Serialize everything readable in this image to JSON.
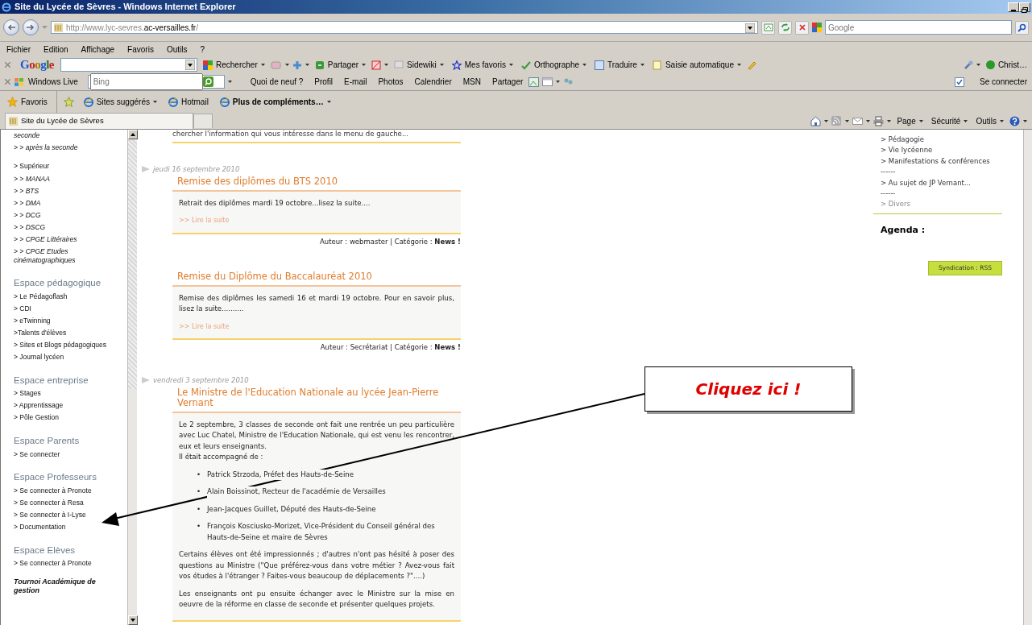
{
  "window": {
    "title": "Site du Lycée de Sèvres - Windows Internet Explorer"
  },
  "address_bar": {
    "url_start": "http://www.lyc-sevres.",
    "url_domain": "ac-versailles.fr",
    "url_end": "/",
    "search_placeholder": "Google"
  },
  "menu": [
    "Fichier",
    "Edition",
    "Affichage",
    "Favoris",
    "Outils",
    "?"
  ],
  "google_toolbar": {
    "logo": "Google",
    "items": [
      "Rechercher",
      "Partager",
      "Sidewiki",
      "Mes favoris",
      "Orthographe",
      "Traduire",
      "Saisie automatique"
    ],
    "user": "Christ…"
  },
  "live_toolbar": {
    "brand": "Windows Live",
    "search_placeholder": "Bing",
    "items": [
      "Quoi de neuf ?",
      "Profil",
      "E-mail",
      "Photos",
      "Calendrier",
      "MSN",
      "Partager"
    ],
    "connect": "Se connecter"
  },
  "favorites_bar": {
    "favorites": "Favoris",
    "items": [
      {
        "label": "Sites suggérés",
        "kind": "link"
      },
      {
        "label": "Hotmail",
        "kind": "plain"
      },
      {
        "label": "Plus de compléments…",
        "kind": "gallery"
      }
    ]
  },
  "tab": {
    "title": "Site du Lycée de Sèvres"
  },
  "command_bar": [
    "Page",
    "Sécurité",
    "Outils"
  ],
  "sidebar": {
    "sections": [
      {
        "items": [
          {
            "label": "seconde",
            "kind": "sub"
          },
          {
            "label": "> > après la seconde",
            "kind": "sub"
          }
        ]
      },
      {
        "items": [
          {
            "label": "> Supérieur",
            "kind": "link"
          },
          {
            "label": "> > MANAA",
            "kind": "sub"
          },
          {
            "label": "> > BTS",
            "kind": "sub"
          },
          {
            "label": "> > DMA",
            "kind": "sub"
          },
          {
            "label": "> > DCG",
            "kind": "sub"
          },
          {
            "label": "> > DSCG",
            "kind": "sub"
          },
          {
            "label": "> > CPGE Littéraires",
            "kind": "sub"
          },
          {
            "label": "> > CPGE Etudes cinématographiques",
            "kind": "sub"
          }
        ]
      },
      {
        "heading": "Espace pédagogique",
        "items": [
          {
            "label": "> Le Pédagoflash",
            "kind": "link"
          },
          {
            "label": "> CDI",
            "kind": "link"
          },
          {
            "label": "> eTwinning",
            "kind": "link"
          },
          {
            "label": ">Talents d'élèves",
            "kind": "link"
          },
          {
            "label": "> Sites et Blogs pédagogiques",
            "kind": "link"
          },
          {
            "label": "> Journal lycéen",
            "kind": "link"
          }
        ]
      },
      {
        "heading": "Espace entreprise",
        "items": [
          {
            "label": "> Stages",
            "kind": "link"
          },
          {
            "label": "> Apprentissage",
            "kind": "link"
          },
          {
            "label": "> Pôle Gestion",
            "kind": "link"
          }
        ]
      },
      {
        "heading": "Espace Parents",
        "items": [
          {
            "label": "> Se connecter",
            "kind": "link"
          }
        ]
      },
      {
        "heading": "Espace Professeurs",
        "items": [
          {
            "label": "> Se connecter à Pronote",
            "kind": "link"
          },
          {
            "label": "> Se connecter à Resa",
            "kind": "link"
          },
          {
            "label": "> Se connecter à I-Lyse",
            "kind": "link"
          },
          {
            "label": "> Documentation",
            "kind": "link"
          }
        ]
      },
      {
        "heading": "Espace Elèves",
        "items": [
          {
            "label": "> Se connecter à Pronote",
            "kind": "link"
          }
        ]
      },
      {
        "items": [
          {
            "label": "Tournoi Académique de gestion",
            "kind": "feature"
          }
        ]
      }
    ]
  },
  "main": {
    "intro": "chercher l'information qui vous intéresse dans le menu de gauche...",
    "days": [
      {
        "date": "jeudi 16 septembre 2010",
        "articles": [
          {
            "title": "Remise des diplômes du BTS 2010",
            "blocks": [
              {
                "kind": "paragraph",
                "lines": [
                  "Retrait des diplômes mardi 19 octobre...lisez la suite...."
                ]
              }
            ],
            "read_more": ">> Lire la suite",
            "footer": "Auteur : webmaster | Catégorie : **News !**"
          },
          {
            "title": "Remise du Diplôme du Baccalauréat 2010",
            "blocks": [
              {
                "kind": "paragraph",
                "lines": [
                  "Remise des diplômes les samedi 16 et mardi 19 octobre. Pour en savoir plus, lisez la suite.........."
                ]
              }
            ],
            "read_more": ">> Lire la suite",
            "footer": "Auteur : Secrétariat | Catégorie : **News !**"
          }
        ]
      },
      {
        "date": "vendredi 3 septembre 2010",
        "articles": [
          {
            "title": "Le Ministre de l'Education Nationale au lycée Jean-Pierre Vernant",
            "blocks": [
              {
                "kind": "paragraph",
                "lines": [
                  "Le 2 septembre, 3 classes de seconde ont fait une rentrée un peu particulière avec Luc Chatel, Ministre de l'Education Nationale, qui est venu les rencontrer, eux et leurs enseignants.",
                  "Il était accompagné de :"
                ]
              },
              {
                "kind": "list",
                "bullet": "•",
                "items": [
                  "Patrick Strzoda, Préfet des Hauts-de-Seine",
                  "Alain Boissinot, Recteur de l'académie de Versailles",
                  "Jean-Jacques Guillet, Député des Hauts-de-Seine",
                  "François Kosciusko-Morizet, Vice-Président du Conseil général des Hauts-de-Seine et maire de Sèvres"
                ]
              },
              {
                "kind": "paragraph",
                "lines": [
                  "Certains élèves ont été impressionnés ; d'autres n'ont pas hésité à poser des questions au Ministre (\"Que préférez-vous dans votre métier ? Avez-vous fait vos études à l'étranger ? Faites-vous beaucoup de déplacements ?\"....)"
                ]
              },
              {
                "kind": "paragraph",
                "lines": [
                  "Les enseignants ont pu ensuite échanger avec le Ministre sur la mise en oeuvre de la réforme en classe de seconde et présenter quelques projets."
                ]
              }
            ]
          }
        ]
      }
    ]
  },
  "right_column": {
    "links": [
      {
        "label": "> Pédagogie",
        "kind": "link",
        "visited": false
      },
      {
        "label": "> Vie lycéenne",
        "kind": "link",
        "visited": false
      },
      {
        "label": "> Manifestations & conférences",
        "kind": "link",
        "visited": false
      },
      {
        "label": "------",
        "kind": "separator"
      },
      {
        "label": "> Au sujet de JP Vernant...",
        "kind": "link",
        "visited": false
      },
      {
        "label": "------",
        "kind": "separator"
      },
      {
        "label": "> Divers",
        "kind": "link",
        "visited": true
      }
    ],
    "agenda": "Agenda :",
    "syndication": "Syndication : RSS"
  },
  "callout": {
    "text": "Cliquez ici !"
  }
}
